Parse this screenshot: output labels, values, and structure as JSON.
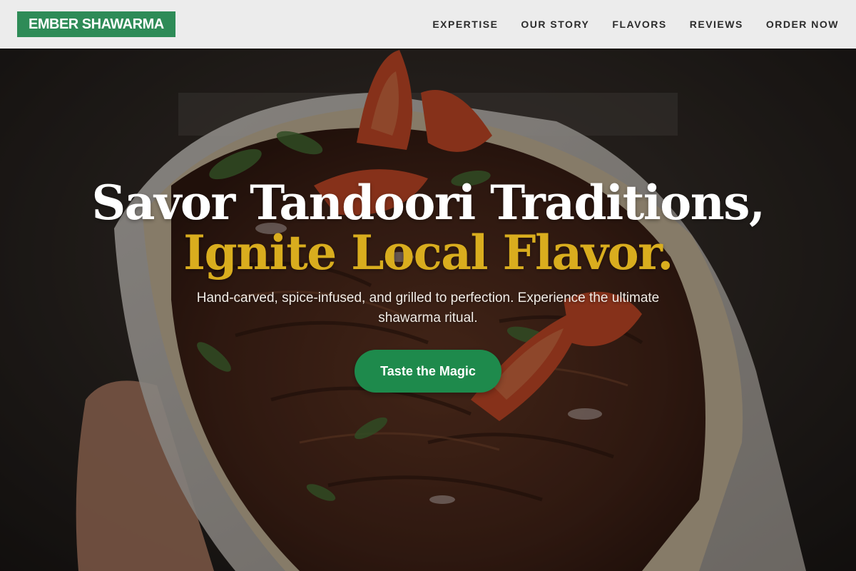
{
  "brand": {
    "name": "EMBER SHAWARMA",
    "color": "#2e8b57"
  },
  "nav": {
    "items": [
      {
        "label": "EXPERTISE"
      },
      {
        "label": "OUR STORY"
      },
      {
        "label": "FLAVORS"
      },
      {
        "label": "REVIEWS"
      },
      {
        "label": "ORDER NOW"
      }
    ]
  },
  "hero": {
    "headline_line1": "Savor Tandoori Traditions,",
    "headline_line2": "Ignite Local Flavor.",
    "subtitle": "Hand-carved, spice-infused, and grilled to perfection. Experience the ultimate shawarma ritual.",
    "cta_label": "Taste the Magic",
    "accent_color": "#d9ad1e",
    "cta_color": "#1e8a4c"
  }
}
